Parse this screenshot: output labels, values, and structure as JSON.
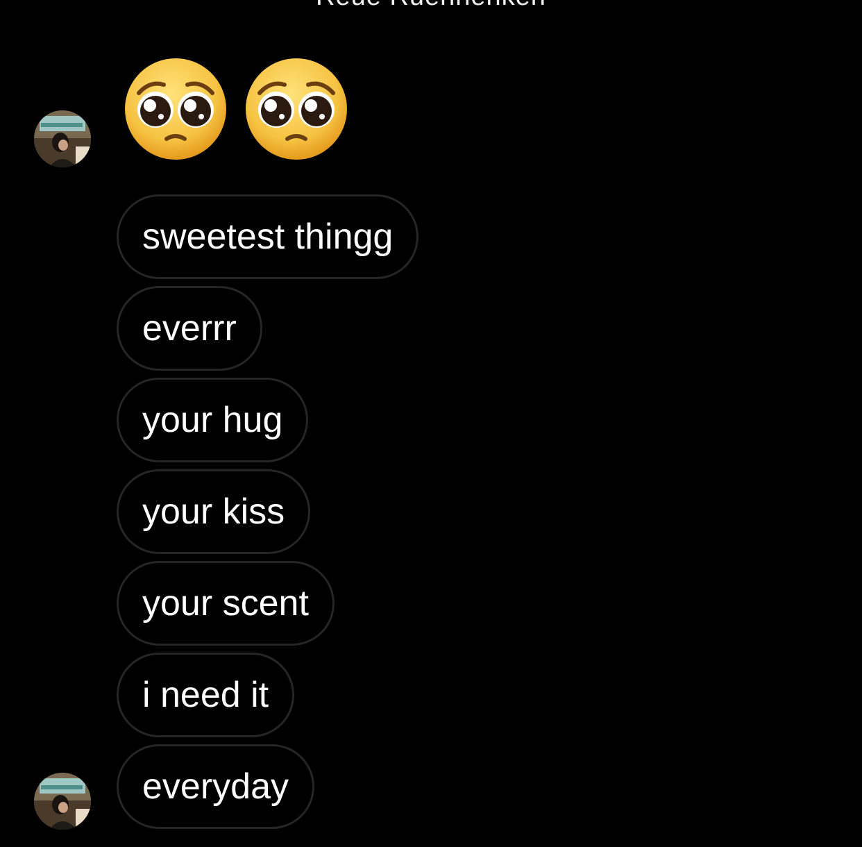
{
  "header": {
    "partial_title": "Reue Ruennenken"
  },
  "conversation": {
    "reaction_emojis": [
      {
        "icon": "pleading-face-emoji",
        "char": "🥺"
      },
      {
        "icon": "pleading-face-emoji",
        "char": "🥺"
      }
    ],
    "messages": [
      {
        "text": "sweetest thingg"
      },
      {
        "text": "everrr"
      },
      {
        "text": "your hug"
      },
      {
        "text": "your kiss"
      },
      {
        "text": "your scent"
      },
      {
        "text": "i need it"
      },
      {
        "text": "everyday"
      }
    ]
  },
  "colors": {
    "background": "#000000",
    "bubble_border": "#262626",
    "text": "#ffffff",
    "emoji_face": "#f6c343"
  }
}
